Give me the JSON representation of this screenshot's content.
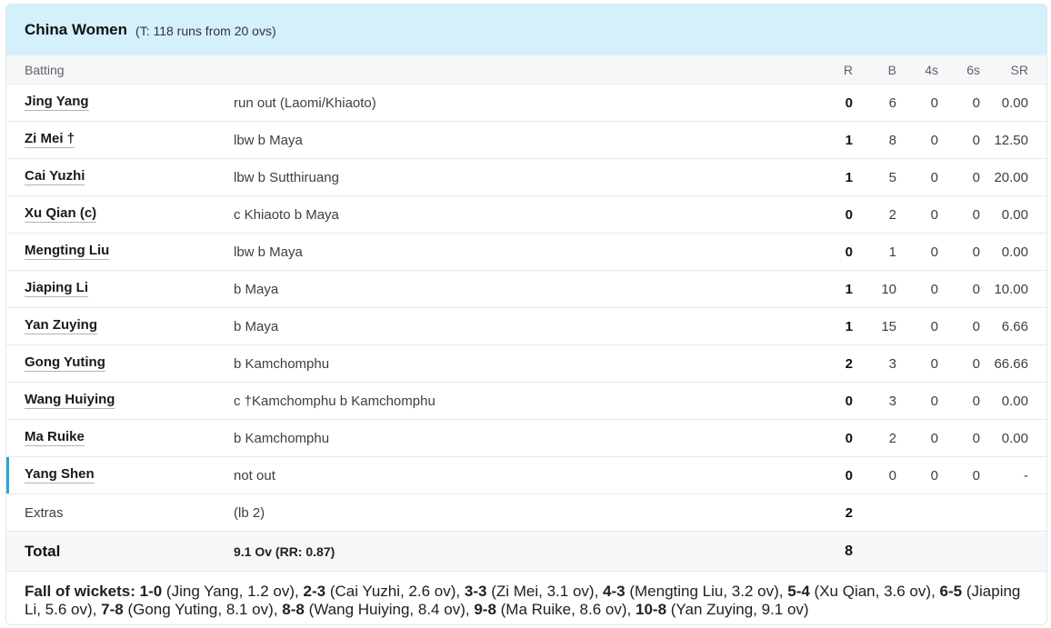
{
  "team": {
    "name": "China Women",
    "target": "(T: 118 runs from 20 ovs)"
  },
  "columns": {
    "batting": "Batting",
    "runs": "R",
    "balls": "B",
    "fours": "4s",
    "sixes": "6s",
    "sr": "SR"
  },
  "batters": [
    {
      "name": "Jing Yang",
      "dismissal": "run out (Laomi/Khiaoto)",
      "r": "0",
      "b": "6",
      "fours": "0",
      "sixes": "0",
      "sr": "0.00"
    },
    {
      "name": "Zi Mei †",
      "dismissal": "lbw b Maya",
      "r": "1",
      "b": "8",
      "fours": "0",
      "sixes": "0",
      "sr": "12.50"
    },
    {
      "name": "Cai Yuzhi",
      "dismissal": "lbw b Sutthiruang",
      "r": "1",
      "b": "5",
      "fours": "0",
      "sixes": "0",
      "sr": "20.00"
    },
    {
      "name": "Xu Qian (c)",
      "dismissal": "c Khiaoto b Maya",
      "r": "0",
      "b": "2",
      "fours": "0",
      "sixes": "0",
      "sr": "0.00"
    },
    {
      "name": "Mengting Liu",
      "dismissal": "lbw b Maya",
      "r": "0",
      "b": "1",
      "fours": "0",
      "sixes": "0",
      "sr": "0.00"
    },
    {
      "name": "Jiaping Li",
      "dismissal": "b Maya",
      "r": "1",
      "b": "10",
      "fours": "0",
      "sixes": "0",
      "sr": "10.00"
    },
    {
      "name": "Yan Zuying",
      "dismissal": "b Maya",
      "r": "1",
      "b": "15",
      "fours": "0",
      "sixes": "0",
      "sr": "6.66"
    },
    {
      "name": "Gong Yuting",
      "dismissal": "b Kamchomphu",
      "r": "2",
      "b": "3",
      "fours": "0",
      "sixes": "0",
      "sr": "66.66"
    },
    {
      "name": "Wang Huiying",
      "dismissal": "c †Kamchomphu b Kamchomphu",
      "r": "0",
      "b": "3",
      "fours": "0",
      "sixes": "0",
      "sr": "0.00"
    },
    {
      "name": "Ma Ruike",
      "dismissal": "b Kamchomphu",
      "r": "0",
      "b": "2",
      "fours": "0",
      "sixes": "0",
      "sr": "0.00"
    },
    {
      "name": "Yang Shen",
      "dismissal": "not out",
      "r": "0",
      "b": "0",
      "fours": "0",
      "sixes": "0",
      "sr": "-"
    }
  ],
  "extras": {
    "label": "Extras",
    "detail": "(lb 2)",
    "runs": "2"
  },
  "total": {
    "label": "Total",
    "info": "9.1 Ov (RR: 0.87)",
    "runs": "8"
  },
  "fall_of_wickets": {
    "label": "Fall of wickets:",
    "items": [
      {
        "score": "1-0",
        "detail": "(Jing Yang, 1.2 ov)"
      },
      {
        "score": "2-3",
        "detail": "(Cai Yuzhi, 2.6 ov)"
      },
      {
        "score": "3-3",
        "detail": "(Zi Mei, 3.1 ov)"
      },
      {
        "score": "4-3",
        "detail": "(Mengting Liu, 3.2 ov)"
      },
      {
        "score": "5-4",
        "detail": "(Xu Qian, 3.6 ov)"
      },
      {
        "score": "6-5",
        "detail": "(Jiaping Li, 5.6 ov)"
      },
      {
        "score": "7-8",
        "detail": "(Gong Yuting, 8.1 ov)"
      },
      {
        "score": "8-8",
        "detail": "(Wang Huiying, 8.4 ov)"
      },
      {
        "score": "9-8",
        "detail": "(Ma Ruike, 8.6 ov)"
      },
      {
        "score": "10-8",
        "detail": "(Yan Zuying, 9.1 ov)"
      }
    ]
  },
  "colors": {
    "header_bg": "#d4f0fb",
    "active_marker": "#26a6d9"
  }
}
